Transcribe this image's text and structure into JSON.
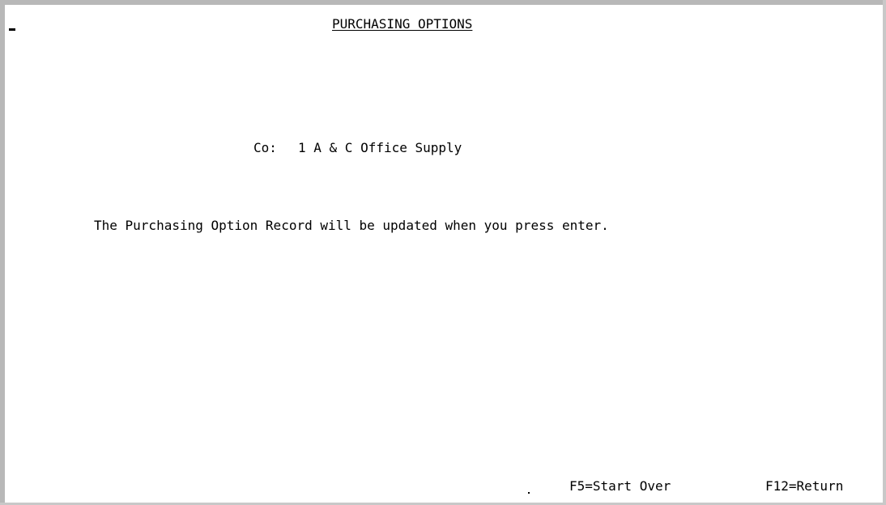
{
  "screen": {
    "title": "PURCHASING OPTIONS",
    "company_label": "Co:",
    "company_value": "1 A & C Office Supply",
    "message": "The Purchasing Option Record will be updated when you press enter."
  },
  "function_keys": {
    "f5": "F5=Start Over",
    "f12": "F12=Return"
  }
}
